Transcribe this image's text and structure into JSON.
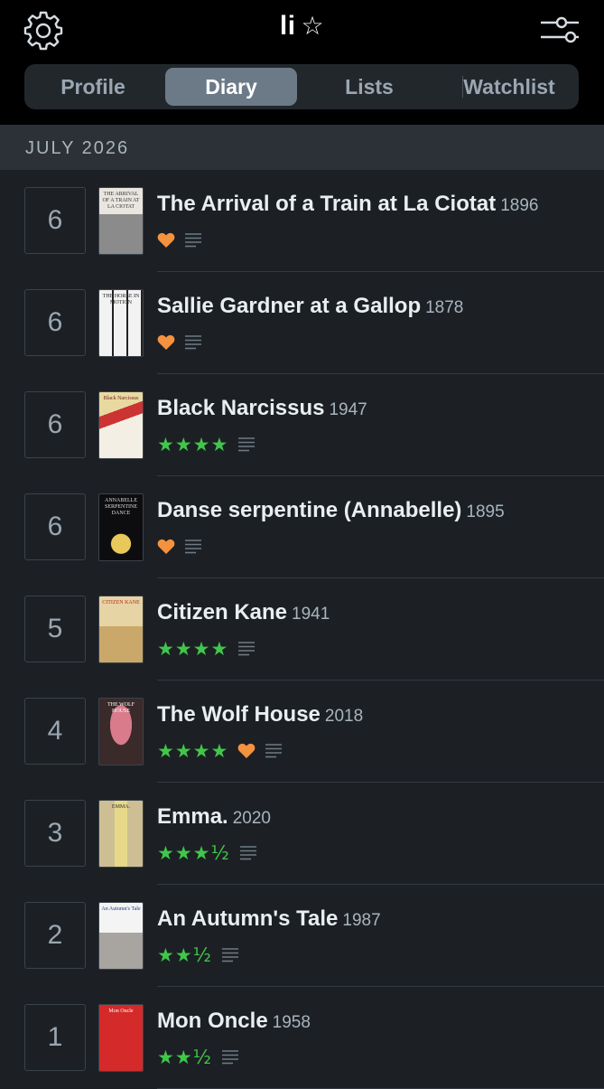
{
  "header": {
    "user": "li",
    "user_badge": "☆"
  },
  "tabs": [
    {
      "label": "Profile",
      "active": false
    },
    {
      "label": "Diary",
      "active": true
    },
    {
      "label": "Lists",
      "active": false
    },
    {
      "label": "Watchlist",
      "active": false
    }
  ],
  "month": "JULY 2026",
  "colors": {
    "heart": "#f5923e",
    "stars": "#40c74a",
    "active_tab": "#6c7a88"
  },
  "entries": [
    {
      "day": "6",
      "title": "The Arrival of a Train at La Ciotat",
      "year": "1896",
      "stars": "",
      "liked": true,
      "poster_text": "THE ARRIVAL OF A TRAIN AT LA CIOTAT"
    },
    {
      "day": "6",
      "title": "Sallie Gardner at a Gallop",
      "year": "1878",
      "stars": "",
      "liked": true,
      "poster_text": "THE HORSE IN MOTION"
    },
    {
      "day": "6",
      "title": "Black Narcissus",
      "year": "1947",
      "stars": "★★★★",
      "liked": false,
      "poster_text": "Black Narcissus"
    },
    {
      "day": "6",
      "title": "Danse serpentine (Annabelle)",
      "year": "1895",
      "stars": "",
      "liked": true,
      "poster_text": "ANNABELLE SERPENTINE DANCE"
    },
    {
      "day": "5",
      "title": "Citizen Kane",
      "year": "1941",
      "stars": "★★★★",
      "liked": false,
      "poster_text": "CITIZEN KANE"
    },
    {
      "day": "4",
      "title": "The Wolf House",
      "year": "2018",
      "stars": "★★★★",
      "liked": true,
      "poster_text": "THE WOLF HOUSE"
    },
    {
      "day": "3",
      "title": "Emma.",
      "year": "2020",
      "stars": "★★★½",
      "liked": false,
      "poster_text": "EMMA."
    },
    {
      "day": "2",
      "title": "An Autumn's Tale",
      "year": "1987",
      "stars": "★★½",
      "liked": false,
      "poster_text": "An Autumn's Tale"
    },
    {
      "day": "1",
      "title": "Mon Oncle",
      "year": "1958",
      "stars": "★★½",
      "liked": false,
      "poster_text": "Mon Oncle"
    }
  ]
}
